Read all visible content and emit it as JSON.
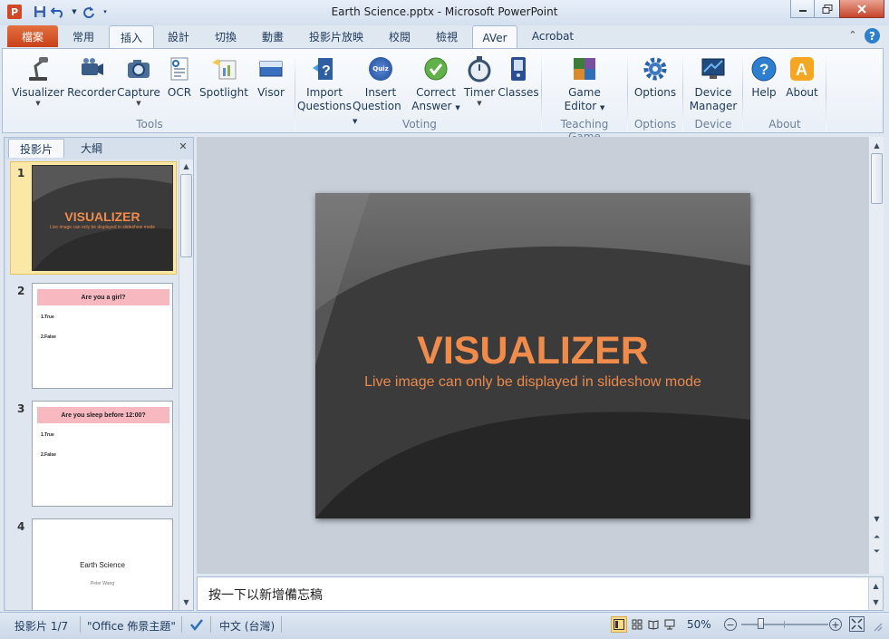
{
  "window": {
    "title": "Earth Science.pptx - Microsoft PowerPoint",
    "app_icon_letter": "P",
    "help_glyph": "?",
    "ribbon_collapse_glyph": "⌃"
  },
  "tabs": [
    "檔案",
    "常用",
    "插入",
    "設計",
    "切換",
    "動畫",
    "投影片放映",
    "校閱",
    "檢視",
    "AVer",
    "Acrobat"
  ],
  "ribbon": {
    "buttons": [
      {
        "label1": "Visualizer",
        "label2": "",
        "icon": "visualizer-icon",
        "caret": true
      },
      {
        "label1": "Recorder",
        "label2": "",
        "icon": "recorder-icon",
        "caret": false
      },
      {
        "label1": "Capture",
        "label2": "",
        "icon": "camera-icon",
        "caret": true
      },
      {
        "label1": "OCR",
        "label2": "",
        "icon": "ocr-icon",
        "caret": false
      },
      {
        "label1": "Spotlight",
        "label2": "",
        "icon": "spotlight-icon",
        "caret": false
      },
      {
        "label1": "Visor",
        "label2": "",
        "icon": "visor-icon",
        "caret": false
      },
      {
        "label1": "Import",
        "label2": "Questions",
        "icon": "import-questions-icon",
        "caret": false
      },
      {
        "label1": "Insert",
        "label2": "Question",
        "icon": "quiz-icon",
        "caret": true
      },
      {
        "label1": "Correct",
        "label2": "Answer",
        "icon": "check-icon",
        "caret": true
      },
      {
        "label1": "Timer",
        "label2": "",
        "icon": "timer-icon",
        "caret": true
      },
      {
        "label1": "Classes",
        "label2": "",
        "icon": "classes-icon",
        "caret": false
      },
      {
        "label1": "Game",
        "label2": "Editor",
        "icon": "game-editor-icon",
        "caret": true
      },
      {
        "label1": "Options",
        "label2": "",
        "icon": "gear-icon",
        "caret": false
      },
      {
        "label1": "Device",
        "label2": "Manager",
        "icon": "device-manager-icon",
        "caret": false
      },
      {
        "label1": "Help",
        "label2": "",
        "icon": "help-icon",
        "caret": false
      },
      {
        "label1": "About",
        "label2": "",
        "icon": "about-icon",
        "caret": false
      }
    ],
    "groups": [
      "Tools",
      "Voting",
      "Teaching Game",
      "Options",
      "Device",
      "About"
    ],
    "quiz_badge": "Quiz"
  },
  "pane": {
    "tabs": [
      "投影片",
      "大綱"
    ],
    "close_glyph": "✕",
    "thumbnails": [
      {
        "num": "1",
        "title": "VISUALIZER",
        "subtitle": "Live image can only be displayed in slideshow mode"
      },
      {
        "num": "2",
        "question": "Are you a girl?",
        "opt1": "1.True",
        "opt2": "2.False"
      },
      {
        "num": "3",
        "question": "Are you sleep before 12:00?",
        "opt1": "1.True",
        "opt2": "2.False"
      },
      {
        "num": "4",
        "title": "Earth Science",
        "author": "Peter Wang"
      }
    ]
  },
  "slide": {
    "title": "VISUALIZER",
    "subtitle": "Live image can only be displayed in slideshow mode"
  },
  "notes": {
    "placeholder": "按一下以新增備忘稿"
  },
  "status": {
    "slide_info": "投影片 1/7",
    "theme": "\"Office 佈景主題\"",
    "language": "中文 (台灣)",
    "zoom": "50%",
    "zoom_fraction": 0.5
  },
  "colors": {
    "file_tab": "#d24726",
    "slide_title": "#ef8c4b",
    "thumb_question_bg": "#f7b8c0"
  }
}
